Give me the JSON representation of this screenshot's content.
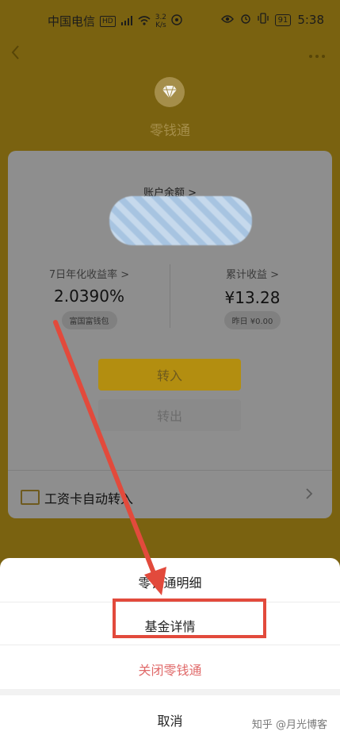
{
  "statusbar": {
    "carrier": "中国电信",
    "hd": "HD",
    "net_speed_top": "3.2",
    "net_speed_bottom": "K/s",
    "battery": "91",
    "time": "5:38"
  },
  "header": {
    "app_name": "零钱通"
  },
  "card": {
    "balance_label": "账户余额 >",
    "left_metric_label": "7日年化收益率 >",
    "left_metric_value": "2.0390%",
    "left_pill": "富国富钱包",
    "right_metric_label": "累计收益 >",
    "right_metric_value": "¥13.28",
    "right_pill": "昨日 ¥0.00",
    "transfer_in": "转入",
    "transfer_out": "转出",
    "auto_transfer_label": "工资卡自动转入"
  },
  "sheet": {
    "option_details": "零钱通明细",
    "option_fund": "基金详情",
    "option_close": "关闭零钱通",
    "option_cancel": "取消"
  },
  "watermark": "知乎 @月光博客",
  "colors": {
    "overlay_bg": "#7a6210",
    "highlight_box": "#e24a3c",
    "annotation_arrow": "#e24a3c",
    "danger_text": "#e06a6a"
  }
}
